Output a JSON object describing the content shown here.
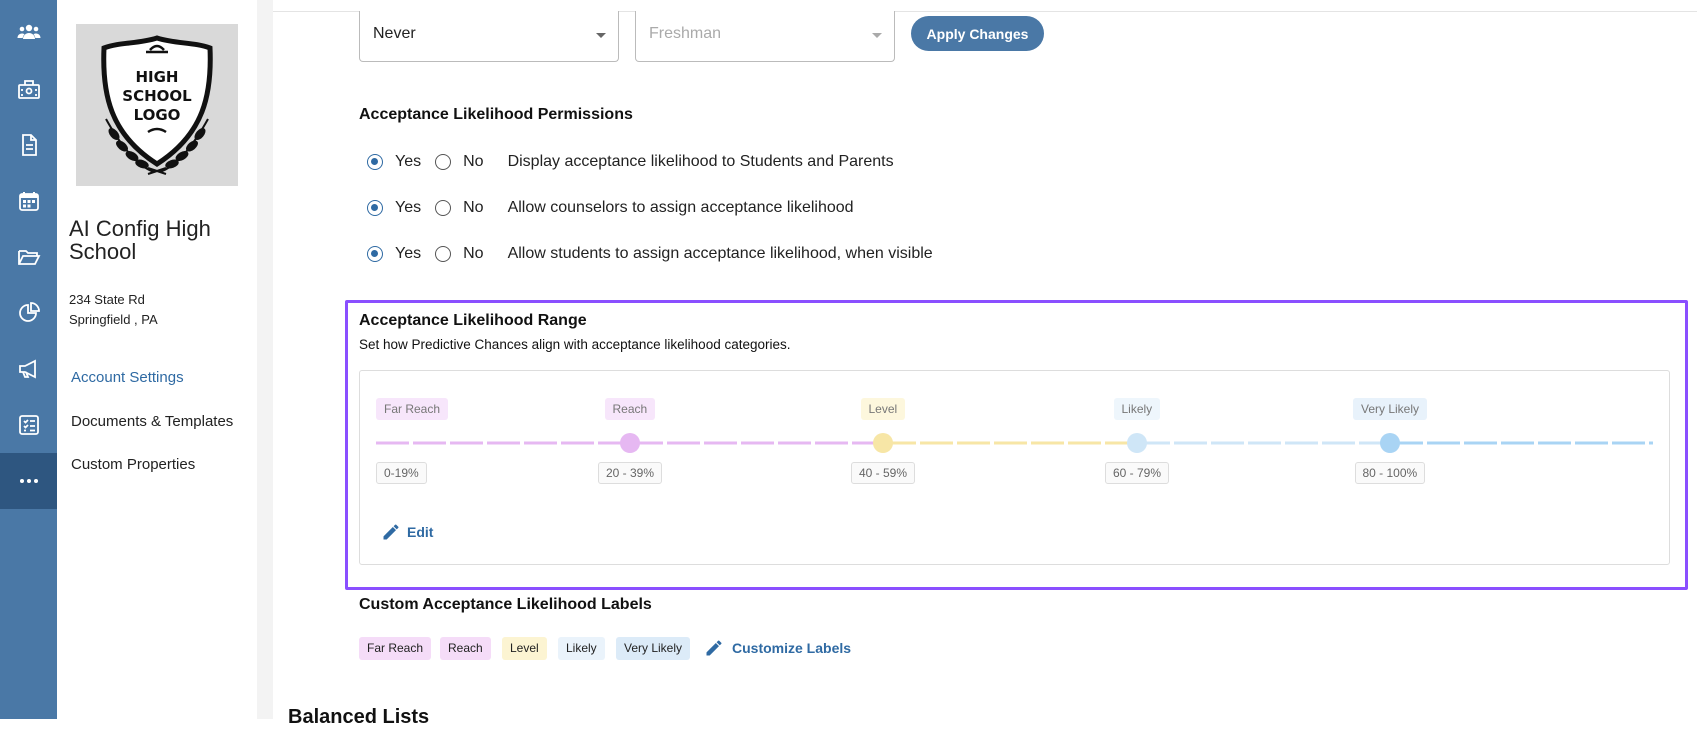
{
  "rail": {
    "icons": [
      "users-icon",
      "school-icon",
      "document-icon",
      "calendar-icon",
      "folder-icon",
      "pie-chart-icon",
      "megaphone-icon",
      "checklist-icon",
      "more-icon"
    ],
    "active_color": "#2e5680",
    "bg_color": "#4a78a6"
  },
  "school": {
    "logo_line1": "HIGH",
    "logo_line2": "SCHOOL",
    "logo_line3": "LOGO",
    "name": "AI Config High School",
    "address1": "234 State Rd",
    "address2": "Springfield , PA"
  },
  "sidenav": {
    "account_settings": "Account Settings",
    "documents_templates": "Documents & Templates",
    "custom_properties": "Custom Properties"
  },
  "filters": {
    "select1_value": "Never",
    "select2_value": "Freshman",
    "apply_label": "Apply Changes"
  },
  "permissions": {
    "title": "Acceptance Likelihood Permissions",
    "yes_label": "Yes",
    "no_label": "No",
    "rows": [
      {
        "desc": "Display acceptance likelihood to Students and Parents",
        "value": "Yes"
      },
      {
        "desc": "Allow counselors to assign acceptance likelihood",
        "value": "Yes"
      },
      {
        "desc": "Allow students to assign acceptance likelihood, when visible",
        "value": "Yes"
      }
    ]
  },
  "range": {
    "title": "Acceptance Likelihood Range",
    "subtitle": "Set how Predictive Chances align with acceptance likelihood categories.",
    "categories": [
      {
        "label": "Far Reach",
        "range": "0-19%",
        "color": "#e6b8f2",
        "bg": "#f7e6fb"
      },
      {
        "label": "Reach",
        "range": "20 - 39%",
        "color": "#e6b8f2",
        "bg": "#f7e6fb"
      },
      {
        "label": "Level",
        "range": "40 - 59%",
        "color": "#f7e6a6",
        "bg": "#fdf7dd"
      },
      {
        "label": "Likely",
        "range": "60 - 79%",
        "color": "#cfe6f7",
        "bg": "#eef6fc"
      },
      {
        "label": "Very Likely",
        "range": "80 - 100%",
        "color": "#a9d4f4",
        "bg": "#e8f2fb"
      }
    ],
    "edit_label": "Edit"
  },
  "custom_labels": {
    "title": "Custom Acceptance Likelihood Labels",
    "chips": [
      {
        "label": "Far Reach",
        "bg": "#f5dcf8"
      },
      {
        "label": "Reach",
        "bg": "#f5dcf8"
      },
      {
        "label": "Level",
        "bg": "#fcf4d2"
      },
      {
        "label": "Likely",
        "bg": "#eaf3fb"
      },
      {
        "label": "Very Likely",
        "bg": "#dcebf8"
      }
    ],
    "customize_label": "Customize Labels"
  },
  "balanced_lists": {
    "title": "Balanced Lists"
  }
}
